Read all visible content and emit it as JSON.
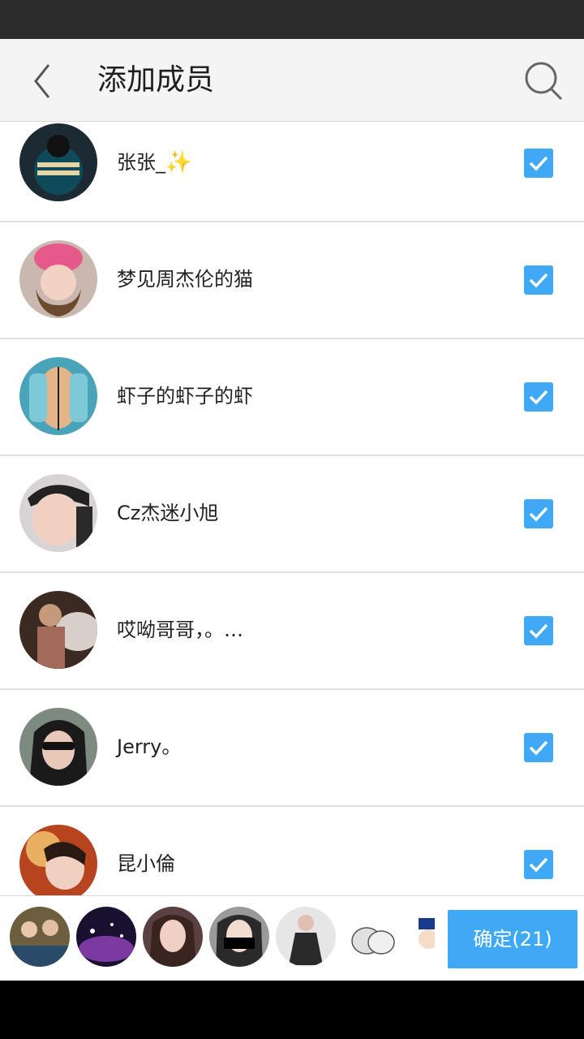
{
  "header": {
    "title": "添加成员"
  },
  "members": [
    {
      "name": "张张_",
      "sparkle": "✨",
      "checked": true,
      "avatar_color": "#1b2a33"
    },
    {
      "name": "梦见周杰伦的猫",
      "checked": true,
      "avatar_color": "#e7b9b2"
    },
    {
      "name": "虾子的虾子的虾",
      "checked": true,
      "avatar_color": "#4aa3b8"
    },
    {
      "name": "Cz杰迷小旭",
      "checked": true,
      "avatar_color": "#d8c8c0"
    },
    {
      "name": "哎呦哥哥，。…",
      "checked": true,
      "avatar_color": "#6b4a3a"
    },
    {
      "name": "Jerry。",
      "checked": true,
      "avatar_color": "#4a4f52"
    },
    {
      "name": "昆小倫",
      "checked": true,
      "avatar_color": "#b8431f"
    }
  ],
  "selected_avatars": [
    {
      "color": "#6e5e40"
    },
    {
      "color": "#3a2452"
    },
    {
      "color": "#a27a68"
    },
    {
      "color": "#8a8a8a"
    },
    {
      "color": "#dddddd"
    },
    {
      "color": "#f0f0f0"
    },
    {
      "color": "#e0e8f0"
    }
  ],
  "confirm": {
    "label": "确定(21)"
  },
  "colors": {
    "accent": "#3fa9f5",
    "header_bg": "#f4f4f4",
    "status_bar": "#2b2b2b"
  },
  "icons": {
    "back": "chevron-left-icon",
    "search": "search-icon",
    "check": "checkbox-checked-icon"
  }
}
